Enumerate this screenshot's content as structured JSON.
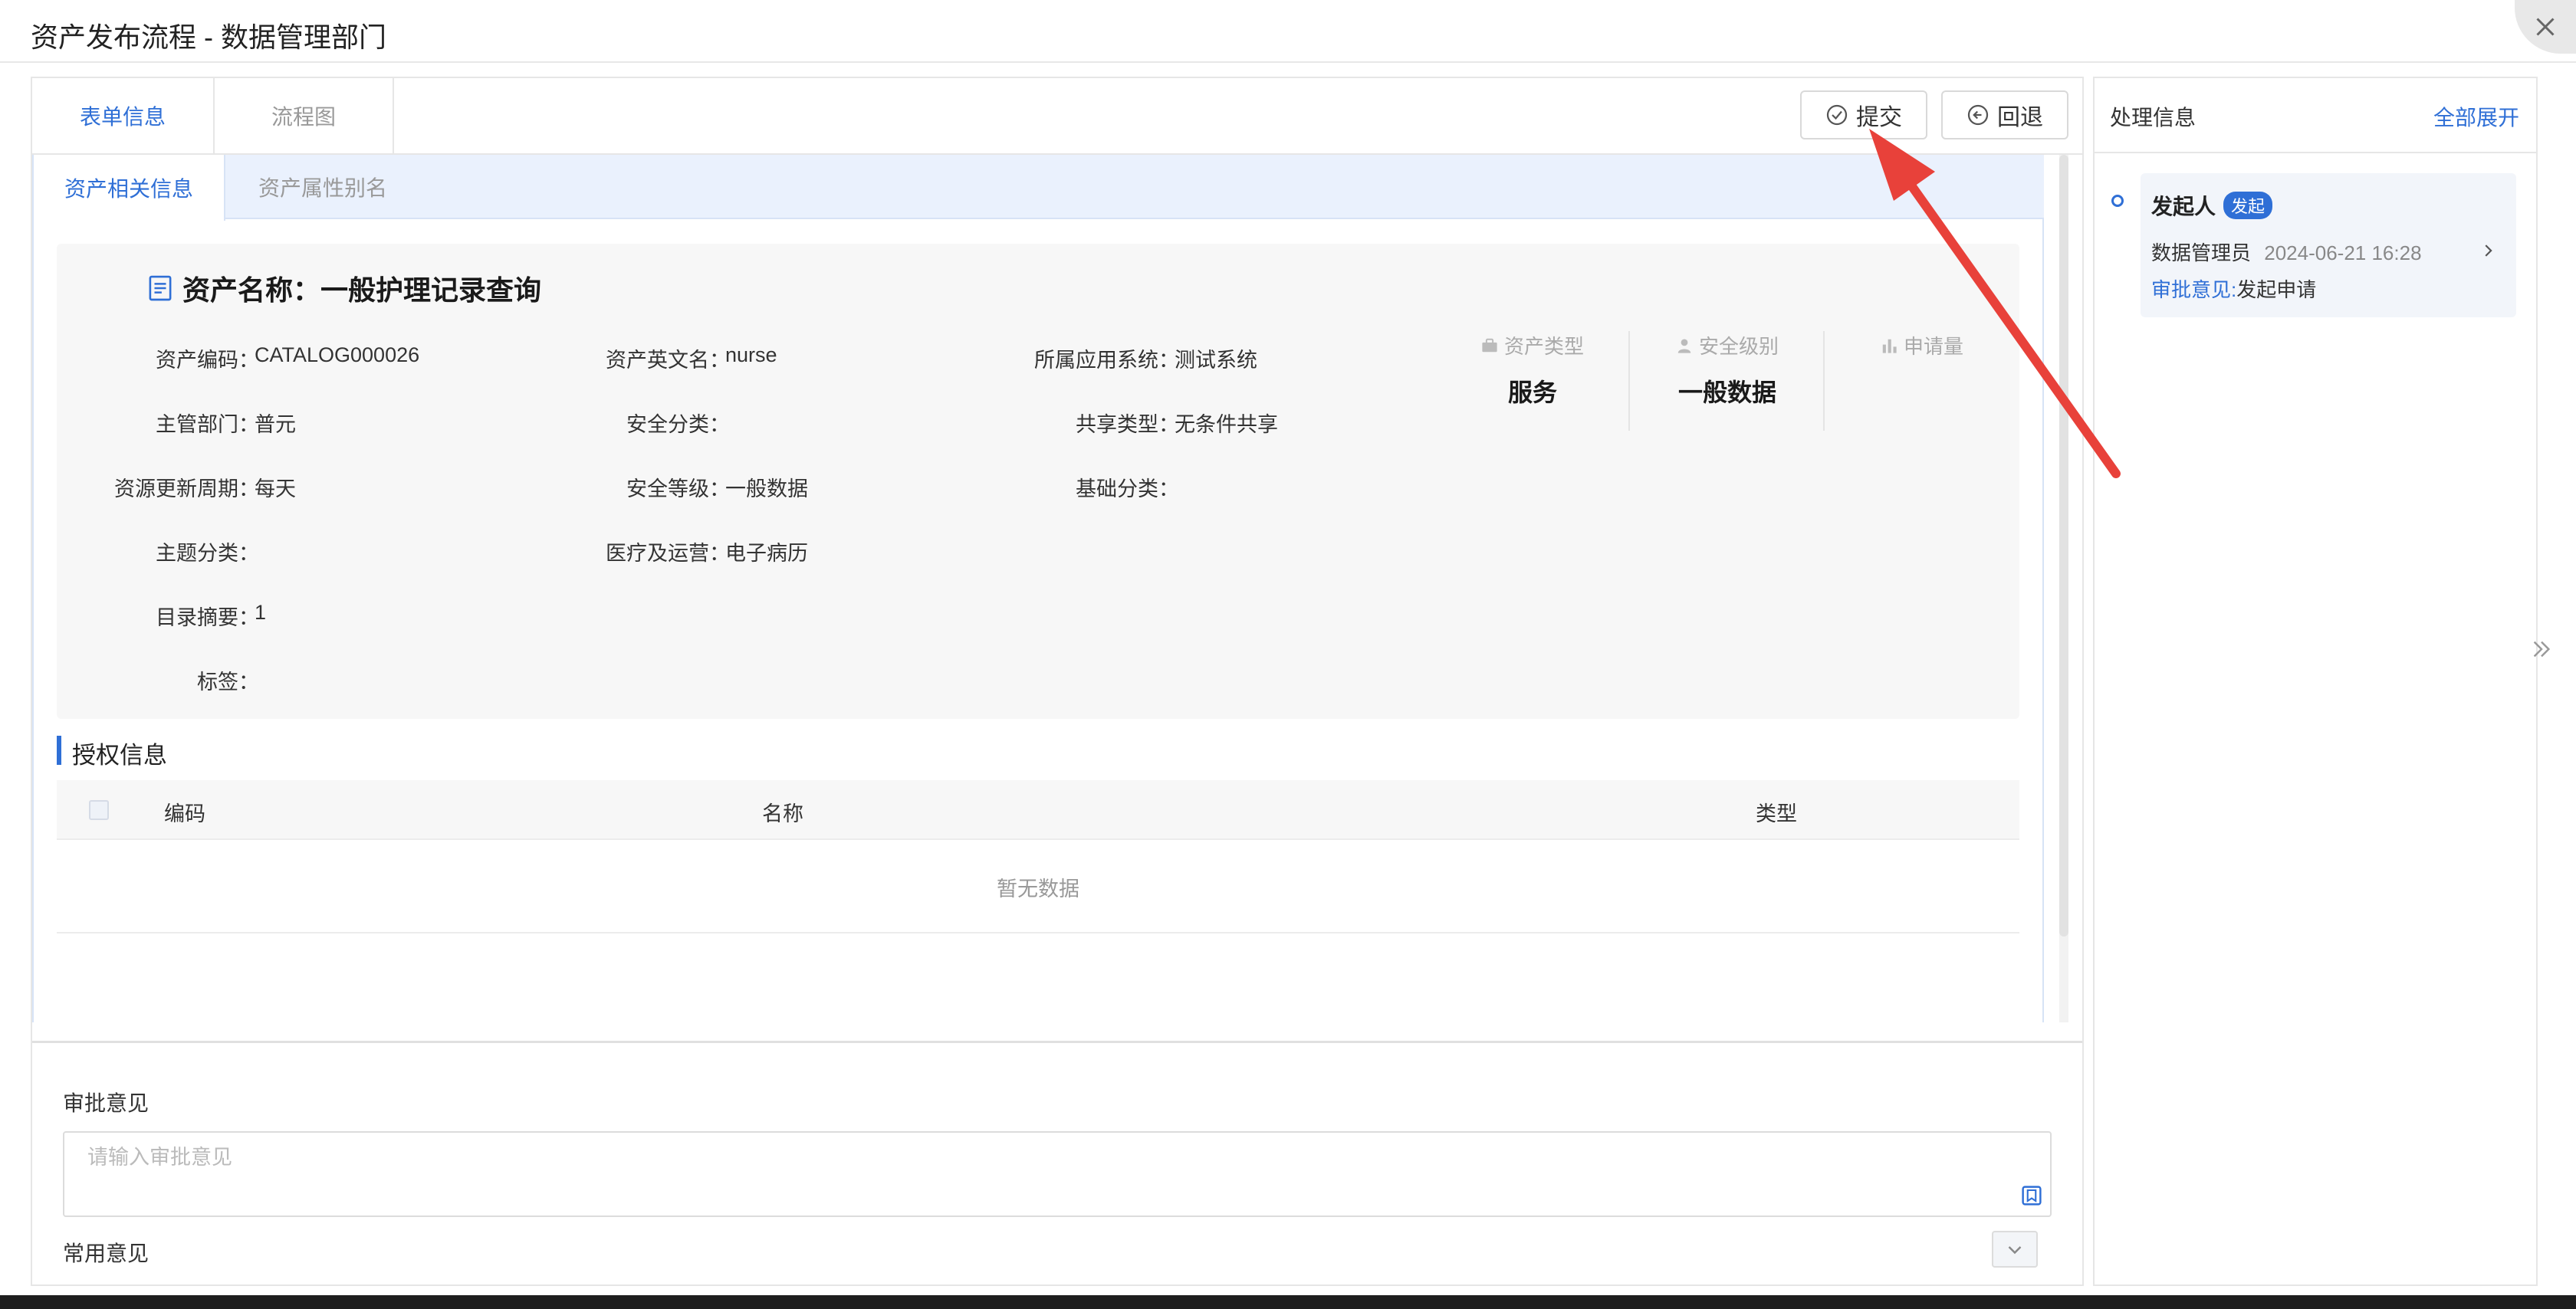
{
  "dialog": {
    "title": "资产发布流程 - 数据管理部门"
  },
  "tabs": {
    "form_info": "表单信息",
    "flowchart": "流程图"
  },
  "toolbar": {
    "submit_label": "提交",
    "rollback_label": "回退"
  },
  "subtabs": {
    "related": "资产相关信息",
    "alias": "资产属性别名"
  },
  "asset": {
    "title": "资产名称：一般护理记录查询",
    "fields": {
      "code_label": "资产编码：",
      "code_value": "CATALOG000026",
      "en_name_label": "资产英文名：",
      "en_name_value": "nurse",
      "system_label": "所属应用系统：",
      "system_value": "测试系统",
      "dept_label": "主管部门：",
      "dept_value": "普元",
      "sec_class_label": "安全分类：",
      "sec_class_value": "",
      "share_label": "共享类型：",
      "share_value": "无条件共享",
      "cycle_label": "资源更新周期：",
      "cycle_value": "每天",
      "sec_level_label": "安全等级：",
      "sec_level_value": "一般数据",
      "base_class_label": "基础分类：",
      "base_class_value": "",
      "topic_label": "主题分类：",
      "topic_value": "",
      "medical_label": "医疗及运营：",
      "medical_value": "电子病历",
      "summary_label": "目录摘要：",
      "summary_value": "1",
      "tags_label": "标签：",
      "tags_value": ""
    },
    "stats": [
      {
        "label": "资产类型",
        "value": "服务",
        "icon": "briefcase-icon"
      },
      {
        "label": "安全级别",
        "value": "一般数据",
        "icon": "user-icon"
      },
      {
        "label": "申请量",
        "value": "",
        "icon": "bar-chart-icon"
      }
    ]
  },
  "auth": {
    "section_title": "授权信息",
    "columns": [
      "编码",
      "名称",
      "类型"
    ],
    "empty_text": "暂无数据"
  },
  "approval": {
    "label": "审批意见",
    "placeholder": "请输入审批意见",
    "value": "",
    "common_label": "常用意见"
  },
  "process_panel": {
    "title": "处理信息",
    "expand_all": "全部展开",
    "timeline": [
      {
        "name": "发起人",
        "badge": "发起",
        "operator": "数据管理员",
        "time": "2024-06-21 16:28",
        "opinion_label": "审批意见:",
        "opinion": "发起申请"
      }
    ]
  },
  "colors": {
    "accent": "#2f6fd6",
    "annotation": "#e8413a"
  }
}
